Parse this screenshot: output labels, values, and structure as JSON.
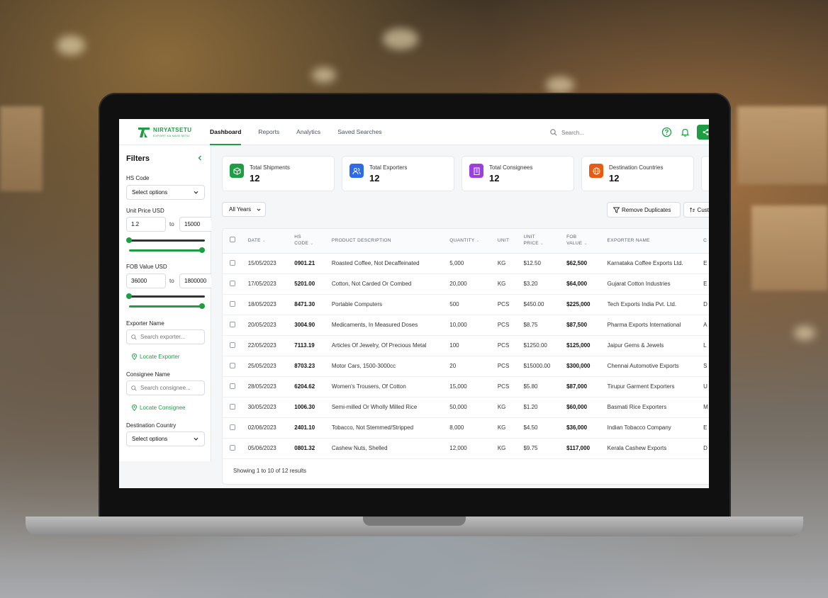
{
  "nav": {
    "logo_name": "NIRYATSETU",
    "logo_tagline": "EXPORT KA NAYA SETU",
    "items": [
      {
        "label": "Dashboard",
        "active": true
      },
      {
        "label": "Reports"
      },
      {
        "label": "Analytics"
      },
      {
        "label": "Saved Searches"
      }
    ],
    "search_placeholder": "Search..."
  },
  "filters": {
    "title": "Filters",
    "hs_code": {
      "label": "HS Code",
      "value": "Select options"
    },
    "unit_price": {
      "label": "Unit Price USD",
      "min": "1.2",
      "max": "15000",
      "to": "to"
    },
    "fob_value": {
      "label": "FOB Value USD",
      "min": "36000",
      "max": "1800000",
      "to": "to"
    },
    "exporter": {
      "label": "Exporter Name",
      "placeholder": "Search exporter...",
      "link": "Locate Exporter"
    },
    "consignee": {
      "label": "Consignee Name",
      "placeholder": "Search consignee...",
      "link": "Locate Consignee"
    },
    "destination": {
      "label": "Destination Country",
      "value": "Select options"
    }
  },
  "stats": [
    {
      "label": "Total Shipments",
      "value": "12",
      "color": "#1f9d45",
      "icon": "box-icon"
    },
    {
      "label": "Total Exporters",
      "value": "12",
      "color": "#2f6be6",
      "icon": "users-icon"
    },
    {
      "label": "Total Consignees",
      "value": "12",
      "color": "#9b3fe0",
      "icon": "building-icon"
    },
    {
      "label": "Destination Countries",
      "value": "12",
      "color": "#ea5a12",
      "icon": "globe-icon"
    }
  ],
  "toolbar": {
    "years": "All Years",
    "remove_duplicates": "Remove Duplicates",
    "customize": "Cust"
  },
  "table": {
    "headers": {
      "date": "DATE",
      "hs_code_1": "HS",
      "hs_code_2": "CODE",
      "product": "PRODUCT DESCRIPTION",
      "quantity": "QUANTITY",
      "unit": "UNIT",
      "unit_price_1": "UNIT",
      "unit_price_2": "PRICE",
      "fob_1": "FOB",
      "fob_2": "VALUE",
      "exporter": "EXPORTER NAME",
      "next": "C"
    },
    "rows": [
      {
        "date": "15/05/2023",
        "hs": "0901.21",
        "product": "Roasted Coffee, Not Decaffeinated",
        "qty": "5,000",
        "unit": "KG",
        "price": "$12.50",
        "fob": "$62,500",
        "exporter": "Karnataka Coffee Exports Ltd.",
        "next": "E"
      },
      {
        "date": "17/05/2023",
        "hs": "5201.00",
        "product": "Cotton, Not Carded Or Combed",
        "qty": "20,000",
        "unit": "KG",
        "price": "$3.20",
        "fob": "$64,000",
        "exporter": "Gujarat Cotton Industries",
        "next": "E"
      },
      {
        "date": "18/05/2023",
        "hs": "8471.30",
        "product": "Portable Computers",
        "qty": "500",
        "unit": "PCS",
        "price": "$450.00",
        "fob": "$225,000",
        "exporter": "Tech Exports India Pvt. Ltd.",
        "next": "D"
      },
      {
        "date": "20/05/2023",
        "hs": "3004.90",
        "product": "Medicaments, In Measured Doses",
        "qty": "10,000",
        "unit": "PCS",
        "price": "$8.75",
        "fob": "$87,500",
        "exporter": "Pharma Exports International",
        "next": "A"
      },
      {
        "date": "22/05/2023",
        "hs": "7113.19",
        "product": "Articles Of Jewelry, Of Precious Metal",
        "qty": "100",
        "unit": "PCS",
        "price": "$1250.00",
        "fob": "$125,000",
        "exporter": "Jaipur Gems & Jewels",
        "next": "L"
      },
      {
        "date": "25/05/2023",
        "hs": "8703.23",
        "product": "Motor Cars, 1500-3000cc",
        "qty": "20",
        "unit": "PCS",
        "price": "$15000.00",
        "fob": "$300,000",
        "exporter": "Chennai Automotive Exports",
        "next": "S"
      },
      {
        "date": "28/05/2023",
        "hs": "6204.62",
        "product": "Women's Trousers, Of Cotton",
        "qty": "15,000",
        "unit": "PCS",
        "price": "$5.80",
        "fob": "$87,000",
        "exporter": "Tirupur Garment Exporters",
        "next": "U"
      },
      {
        "date": "30/05/2023",
        "hs": "1006.30",
        "product": "Semi-milled Or Wholly Milled Rice",
        "qty": "50,000",
        "unit": "KG",
        "price": "$1.20",
        "fob": "$60,000",
        "exporter": "Basmati Rice Exporters",
        "next": "M"
      },
      {
        "date": "02/06/2023",
        "hs": "2401.10",
        "product": "Tobacco, Not Stemmed/Stripped",
        "qty": "8,000",
        "unit": "KG",
        "price": "$4.50",
        "fob": "$36,000",
        "exporter": "Indian Tobacco Company",
        "next": "E"
      },
      {
        "date": "05/06/2023",
        "hs": "0801.32",
        "product": "Cashew Nuts, Shelled",
        "qty": "12,000",
        "unit": "KG",
        "price": "$9.75",
        "fob": "$117,000",
        "exporter": "Kerala Cashew Exports",
        "next": "D"
      }
    ],
    "footer": "Showing 1 to 10 of 12 results"
  }
}
